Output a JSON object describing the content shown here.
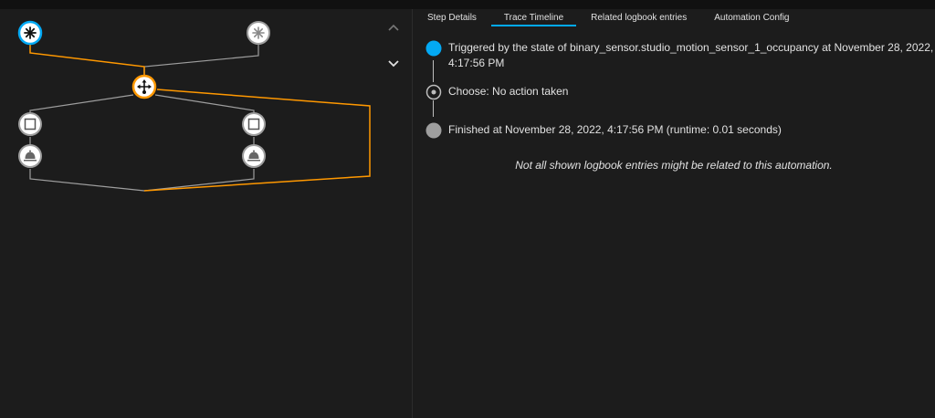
{
  "tabs": [
    {
      "label": "Step Details"
    },
    {
      "label": "Trace Timeline",
      "active": true
    },
    {
      "label": "Related logbook entries"
    },
    {
      "label": "Automation Config"
    }
  ],
  "timeline": [
    {
      "text": "Triggered by the state of binary_sensor.studio_motion_sensor_1_occupancy at November 28, 2022, 4:17:56 PM",
      "icon": "trigger-dot-icon"
    },
    {
      "text": "Choose: No action taken",
      "icon": "choose-ring-icon"
    },
    {
      "text": "Finished at November 28, 2022, 4:17:56 PM (runtime: 0.01 seconds)",
      "icon": "finished-dot-icon"
    }
  ],
  "note": "Not all shown logbook entries might be related to this automation.",
  "graph": {
    "nodes": [
      {
        "name": "trigger-node-1",
        "icon": "asterisk-icon",
        "active": true
      },
      {
        "name": "trigger-node-2",
        "icon": "asterisk-icon",
        "active": false
      },
      {
        "name": "choose-node",
        "icon": "choose-icon",
        "active": true
      },
      {
        "name": "condition-node-left",
        "icon": "square-icon",
        "active": false
      },
      {
        "name": "condition-node-right",
        "icon": "square-icon",
        "active": false
      },
      {
        "name": "service-node-left",
        "icon": "bell-icon",
        "active": false
      },
      {
        "name": "service-node-right",
        "icon": "bell-icon",
        "active": false
      }
    ],
    "collapse_up_icon": "chevron-up-icon",
    "collapse_down_icon": "chevron-down-icon"
  },
  "colors": {
    "accent": "#03a9f4",
    "path_active": "#ff9800",
    "path_inactive": "#9e9e9e",
    "background": "#1c1c1c"
  }
}
